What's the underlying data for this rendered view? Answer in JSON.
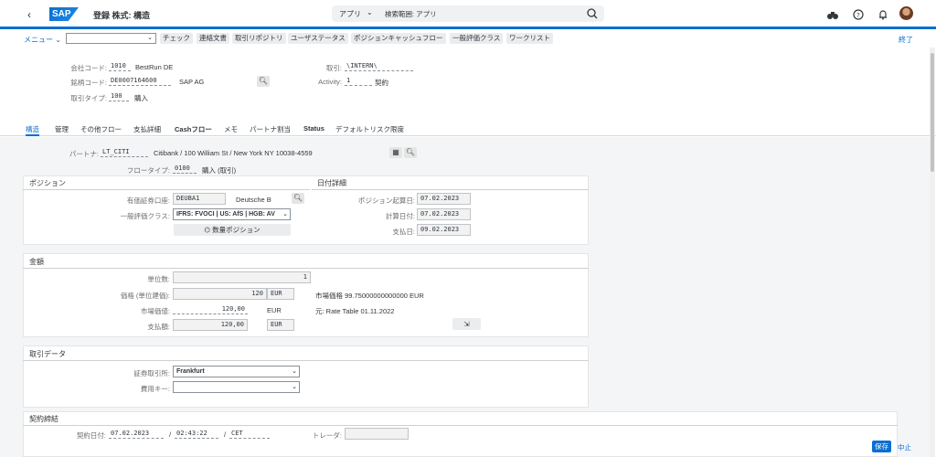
{
  "shell": {
    "app_title": "登録 株式: 構造",
    "logo": "SAP",
    "search_scope": "アプリ",
    "search_placeholder": "検索範囲: アプリ"
  },
  "toolbar": {
    "menu": "メニュー",
    "buttons": [
      "チェック",
      "連絡文書",
      "取引リポジトリ",
      "ユーザステータス",
      "ポジションキャッシュフロー",
      "一般評価クラス",
      "ワークリスト"
    ],
    "exit": "終了"
  },
  "header": {
    "company_code_label": "会社コード:",
    "company_code": "1010",
    "company_name": "BestRun DE",
    "security_label": "銘柄コード:",
    "security_id": "DE0007164600",
    "security_name": "SAP AG",
    "trans_type_label": "取引タイプ:",
    "trans_type": "100",
    "trans_type_text": "購入",
    "transaction_label": "取引:",
    "transaction": "\\INTERN\\",
    "activity_label": "Activity:",
    "activity": "1",
    "activity_text": "契約"
  },
  "tabs": [
    "構造",
    "管理",
    "その他フロー",
    "支払詳細",
    "Cashフロー",
    "メモ",
    "パートナ割当",
    "Status",
    "デフォルトリスク限度"
  ],
  "partner": {
    "label": "パートナ:",
    "value": "LT_CITI",
    "address": "Citibank / 100 William St / New York NY 10038-4559",
    "flow_type_label": "フロータイプ:",
    "flow_type": "0100",
    "flow_type_text": "購入 (取引)"
  },
  "position": {
    "title": "ポジション",
    "account_label": "有価証券口座:",
    "account": "DEUBA1",
    "account_text": "Deutsche B",
    "valuation_label": "一般評価クラス:",
    "valuation": "IFRS: FVOCI | US: AfS | HGB: AV",
    "quantity_button": "数量ポジション"
  },
  "dates": {
    "title": "日付詳細",
    "position_date_label": "ポジション起算日:",
    "position_date": "07.02.2023",
    "calc_date_label": "計算日付:",
    "calc_date": "07.02.2023",
    "payment_date_label": "支払日:",
    "payment_date": "09.02.2023"
  },
  "amount": {
    "title": "金額",
    "units_label": "単位数:",
    "units": "1",
    "price_label": "価格 (単位建価):",
    "price": "120",
    "price_curr": "EUR",
    "market_value_label": "市場価値:",
    "market_value": "120,00",
    "market_value_curr": "EUR",
    "payment_amount_label": "支払額:",
    "payment_amount": "120,00",
    "payment_curr": "EUR",
    "market_price_text": "市場価格 99.75000000000000 EUR",
    "source_text": "元: Rate Table 01.11.2022"
  },
  "trade": {
    "title": "取引データ",
    "exchange_label": "証券取引所:",
    "exchange": "Frankfurt",
    "fee_label": "費用キー:",
    "fee": ""
  },
  "contract": {
    "title": "契約締結",
    "date_label": "契約日付:",
    "date": "07.02.2023",
    "time": "02:43:22",
    "tz": "CET",
    "sep1": "/",
    "sep2": "/",
    "trader_label": "トレーダ:"
  },
  "footer": {
    "save": "保存",
    "cancel": "中止"
  }
}
